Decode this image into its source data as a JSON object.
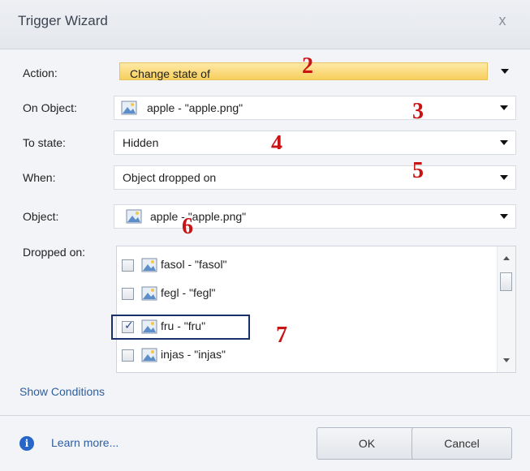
{
  "window": {
    "title": "Trigger Wizard",
    "close_glyph": "x"
  },
  "fields": {
    "action": {
      "label": "Action:",
      "value": "Change state of"
    },
    "on_object": {
      "label": "On Object:",
      "value": "apple - \"apple.png\""
    },
    "to_state": {
      "label": "To state:",
      "value": "Hidden"
    },
    "when": {
      "label": "When:",
      "value": "Object dropped on"
    },
    "object": {
      "label": "Object:",
      "value": "apple - \"apple.png\""
    }
  },
  "dropped_on": {
    "label": "Dropped on:",
    "items": [
      {
        "text": "fasol - \"fasol\"",
        "checked": false
      },
      {
        "text": "fegl - \"fegl\"",
        "checked": false
      },
      {
        "text": "fru - \"fru\"",
        "checked": true
      },
      {
        "text": "injas - \"injas\"",
        "checked": false
      }
    ]
  },
  "annotations": [
    "2",
    "3",
    "4",
    "5",
    "6",
    "7"
  ],
  "links": {
    "show_conditions": "Show Conditions",
    "learn_more": "Learn more..."
  },
  "buttons": {
    "ok": "OK",
    "cancel": "Cancel"
  },
  "icons": {
    "object": "image-icon",
    "info": "info-icon",
    "checkmark": "✓"
  },
  "colors": {
    "highlight_field": "#f8cf5d",
    "annotation": "#c81414",
    "link": "#2f5f9e",
    "selection_box": "#19316b"
  }
}
